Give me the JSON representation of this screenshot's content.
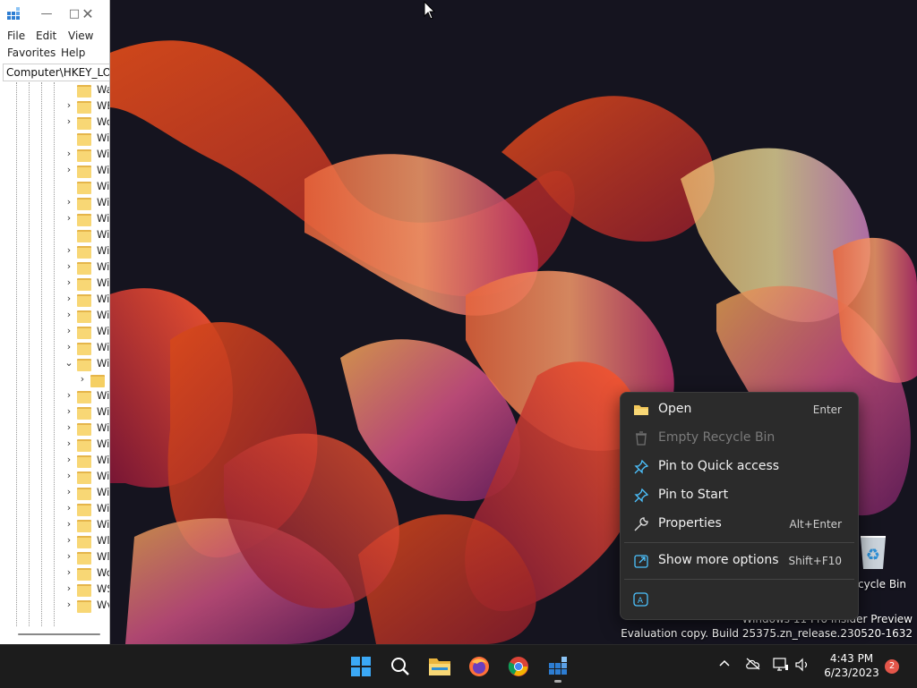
{
  "regedit": {
    "menu": [
      "File",
      "Edit",
      "View",
      "Favorites",
      "Help"
    ],
    "address": "Computer\\HKEY_LOC",
    "tree_rows": [
      {
        "label": "Wa",
        "exp": ""
      },
      {
        "label": "WE",
        "exp": ">"
      },
      {
        "label": "Wo",
        "exp": ">"
      },
      {
        "label": "Wi",
        "exp": ""
      },
      {
        "label": "Wi",
        "exp": ">"
      },
      {
        "label": "Wi",
        "exp": ">"
      },
      {
        "label": "Wi",
        "exp": ""
      },
      {
        "label": "Wi",
        "exp": ">"
      },
      {
        "label": "Wi",
        "exp": ">"
      },
      {
        "label": "Wi",
        "exp": ""
      },
      {
        "label": "Wi",
        "exp": ">"
      },
      {
        "label": "Wi",
        "exp": ">"
      },
      {
        "label": "Wi",
        "exp": ">"
      },
      {
        "label": "Wi",
        "exp": ">"
      },
      {
        "label": "Wi",
        "exp": ">"
      },
      {
        "label": "Wi",
        "exp": ">"
      },
      {
        "label": "Wi",
        "exp": ">"
      },
      {
        "label": "Wi",
        "exp": "v"
      },
      {
        "label": "",
        "exp": ">",
        "child": true
      },
      {
        "label": "Wi",
        "exp": ">"
      },
      {
        "label": "Wi",
        "exp": ">"
      },
      {
        "label": "Wi",
        "exp": ">"
      },
      {
        "label": "Wi",
        "exp": ">"
      },
      {
        "label": "Wi",
        "exp": ">"
      },
      {
        "label": "Wi",
        "exp": ">"
      },
      {
        "label": "Wi",
        "exp": ">"
      },
      {
        "label": "Wi",
        "exp": ">"
      },
      {
        "label": "Wi",
        "exp": ">"
      },
      {
        "label": "Wl",
        "exp": ">"
      },
      {
        "label": "Wl",
        "exp": ">"
      },
      {
        "label": "Wo",
        "exp": ">"
      },
      {
        "label": "WS",
        "exp": ">"
      },
      {
        "label": "Wv",
        "exp": ">"
      }
    ]
  },
  "context_menu": {
    "items": [
      {
        "label": "Open",
        "accel": "Enter",
        "icon": "folder-icon",
        "enabled": true
      },
      {
        "label": "Empty Recycle Bin",
        "accel": "",
        "icon": "trash-icon",
        "enabled": false
      },
      {
        "label": "Pin to Quick access",
        "accel": "",
        "icon": "pin-icon",
        "enabled": true
      },
      {
        "label": "Pin to Start",
        "accel": "",
        "icon": "pin-icon",
        "enabled": true
      },
      {
        "label": "Properties",
        "accel": "Alt+Enter",
        "icon": "wrench-icon",
        "enabled": true
      },
      {
        "label": "Show more options",
        "accel": "Shift+F10",
        "icon": "share-icon",
        "enabled": true
      }
    ],
    "bottom_icon": "text-recognition-icon"
  },
  "desktop": {
    "recycle_bin_label": "cycle Bin",
    "watermark_line1": "Windows 11 Pro Insider Preview",
    "watermark_line2": "Evaluation copy. Build 25375.zn_release.230520-1632"
  },
  "taskbar": {
    "apps": [
      "start-icon",
      "search-icon",
      "file-explorer-icon",
      "firefox-icon",
      "chrome-icon",
      "registry-editor-icon"
    ],
    "tray": [
      "chevron-up-icon",
      "cloud-offline-icon",
      "display-network-icon",
      "volume-icon"
    ],
    "time": "4:43 PM",
    "date": "6/23/2023",
    "notification_count": "2"
  }
}
